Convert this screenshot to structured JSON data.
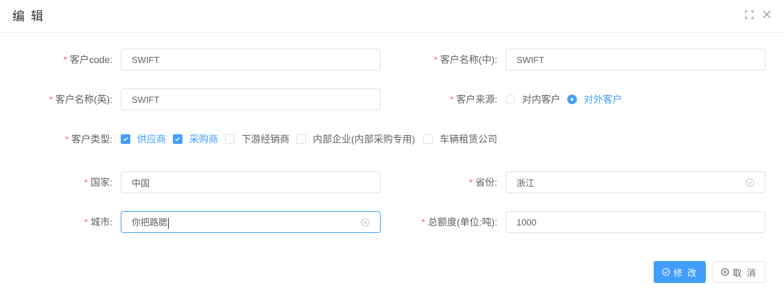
{
  "dialog": {
    "title": "编 辑",
    "maximize_icon": "fullscreen-icon",
    "close_icon": "close-icon"
  },
  "form": {
    "customer_code": {
      "label": "客户code:",
      "value": "SWIFT"
    },
    "customer_name_cn": {
      "label": "客户名称(中):",
      "value": "SWIFT"
    },
    "customer_name_en": {
      "label": "客户名称(英):",
      "value": "SWIFT"
    },
    "customer_source": {
      "label": "客户来源:",
      "options": [
        {
          "label": "对内客户",
          "checked": false
        },
        {
          "label": "对外客户",
          "checked": true
        }
      ]
    },
    "customer_type": {
      "label": "客户类型:",
      "options": [
        {
          "label": "供应商",
          "checked": true
        },
        {
          "label": "采购商",
          "checked": true
        },
        {
          "label": "下游经销商",
          "checked": false
        },
        {
          "label": "内部企业(内部采购专用)",
          "checked": false
        },
        {
          "label": "车辆租赁公司",
          "checked": false
        }
      ]
    },
    "country": {
      "label": "国家:",
      "value": "中国"
    },
    "province": {
      "label": "省份:",
      "value": "浙江"
    },
    "city": {
      "label": "城市:",
      "value": "你把路腮"
    },
    "total_limit": {
      "label": "总额度(单位:吨):",
      "value": "1000"
    }
  },
  "footer": {
    "submit_label": "修 改",
    "cancel_label": "取 消"
  },
  "colors": {
    "primary": "#409eff",
    "required": "#f56c6c",
    "border": "#dcdfe6"
  }
}
